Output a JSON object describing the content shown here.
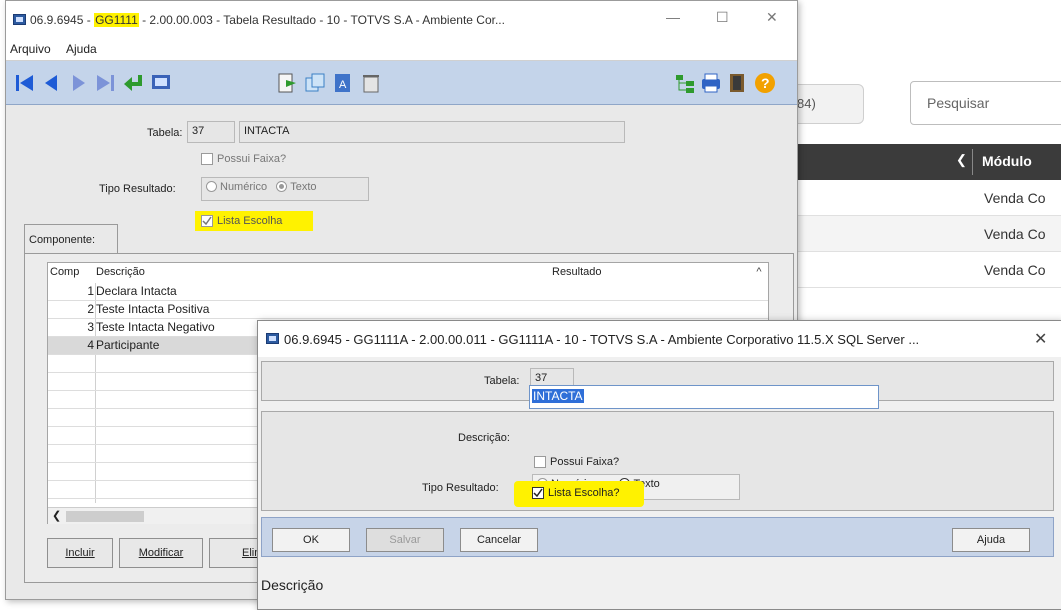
{
  "background_app": {
    "button_label": "84)",
    "search_placeholder": "Pesquisar",
    "header_column": "Módulo",
    "rows": [
      "Venda Co",
      "Venda Co",
      "Venda Co"
    ]
  },
  "window1": {
    "title_prefix": "06.9.6945 - ",
    "title_highlight": "GG1111",
    "title_suffix": " - 2.00.00.003 - Tabela Resultado - 10 - TOTVS S.A - Ambiente Cor...",
    "menu": [
      "Arquivo",
      "Ajuda"
    ],
    "toolbar_icons": [
      "first-record-icon",
      "previous-record-icon",
      "next-record-icon",
      "last-record-icon",
      "return-icon",
      "screen-icon",
      "export-icon",
      "copy-icon",
      "edit-doc-icon",
      "delete-icon",
      "tree-icon",
      "print-icon",
      "exit-icon",
      "help-icon"
    ],
    "form": {
      "tabela_label": "Tabela:",
      "tabela_code": "37",
      "tabela_name": "INTACTA",
      "possui_faixa_label": "Possui Faixa?",
      "tipo_resultado_label": "Tipo Resultado:",
      "radio_numerico": "Numérico",
      "radio_texto": "Texto",
      "lista_escolha_label": "Lista Escolha"
    },
    "tab_label": "Componente:",
    "grid": {
      "headers": [
        "Comp",
        "Descrição",
        "Resultado"
      ],
      "rows": [
        {
          "comp": "1",
          "descricao": "Declara Intacta"
        },
        {
          "comp": "2",
          "descricao": "Teste Intacta Positiva"
        },
        {
          "comp": "3",
          "descricao": "Teste Intacta Negativo"
        },
        {
          "comp": "4",
          "descricao": "Participante"
        }
      ]
    },
    "buttons": [
      "Incluir",
      "Modificar",
      "Elin"
    ]
  },
  "window2": {
    "title": "06.9.6945 - GG1111A - 2.00.00.011 - GG1111A - 10 - TOTVS S.A - Ambiente Corporativo 11.5.X SQL Server ...",
    "tabela_label": "Tabela:",
    "tabela_value": "37",
    "descricao_label": "Descrição:",
    "descricao_value": "INTACTA",
    "possui_faixa_label": "Possui Faixa?",
    "tipo_resultado_label": "Tipo Resultado:",
    "radio_numerico": "Numérico",
    "radio_texto": "Texto",
    "lista_escolha_label": "Lista Escolha?",
    "buttons": {
      "ok": "OK",
      "salvar": "Salvar",
      "cancelar": "Cancelar",
      "ajuda": "Ajuda"
    },
    "footer_label": "Descrição"
  },
  "colors": {
    "highlight": "#fff200",
    "toolbar": "#c4d4ea",
    "selection": "#2f6fd8"
  }
}
